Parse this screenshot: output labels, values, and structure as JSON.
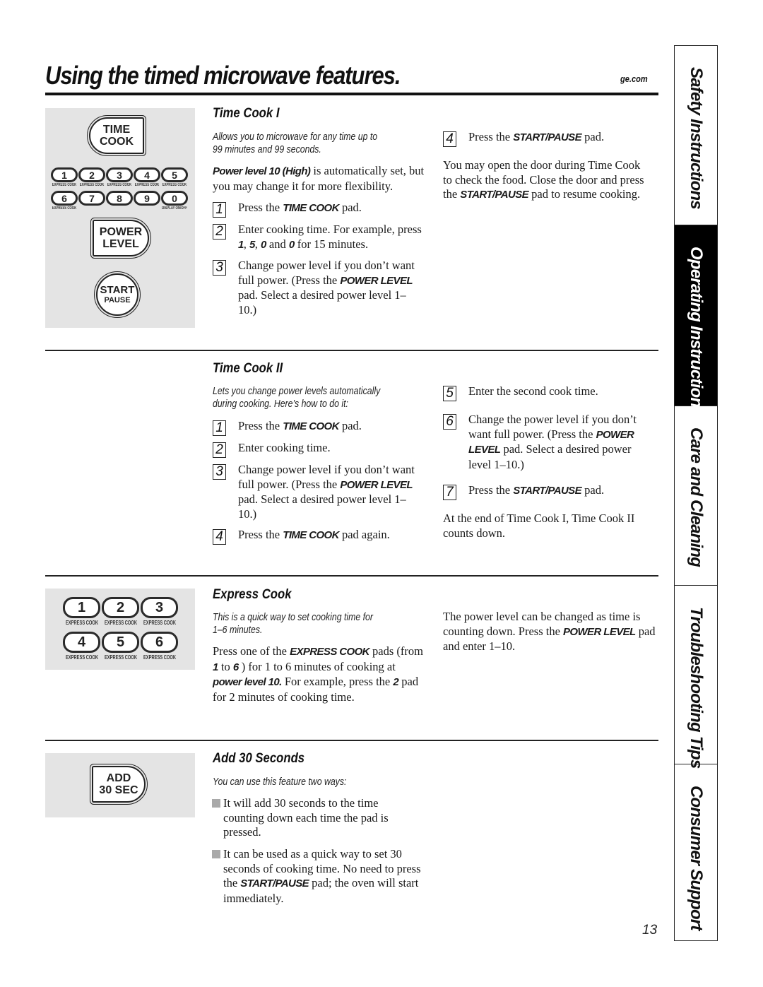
{
  "header": {
    "title": "Using the timed microwave features.",
    "site": "ge.com"
  },
  "side_tabs": [
    {
      "label": "Safety Instructions",
      "active": false
    },
    {
      "label": "Operating Instructions",
      "active": true
    },
    {
      "label": "Care and Cleaning",
      "active": false
    },
    {
      "label": "Troubleshooting Tips",
      "active": false
    },
    {
      "label": "Consumer Support",
      "active": false
    }
  ],
  "page_number": "13",
  "keypad_main": {
    "time_cook": [
      "TIME",
      "COOK"
    ],
    "number_keys_row1": [
      {
        "digit": "1",
        "label": "EXPRESS COOK"
      },
      {
        "digit": "2",
        "label": "EXPRESS COOK"
      },
      {
        "digit": "3",
        "label": "EXPRESS COOK"
      },
      {
        "digit": "4",
        "label": "EXPRESS COOK"
      },
      {
        "digit": "5",
        "label": "EXPRESS COOK"
      }
    ],
    "number_keys_row2": [
      {
        "digit": "6",
        "label": "EXPRESS COOK"
      },
      {
        "digit": "7",
        "label": ""
      },
      {
        "digit": "8",
        "label": ""
      },
      {
        "digit": "9",
        "label": ""
      },
      {
        "digit": "0",
        "label": "DISPLAY ON/OFF"
      }
    ],
    "power_level": [
      "POWER",
      "LEVEL"
    ],
    "start_pause": [
      "START",
      "PAUSE"
    ]
  },
  "keypad_express": {
    "keys": [
      {
        "digit": "1",
        "label": "EXPRESS COOK"
      },
      {
        "digit": "2",
        "label": "EXPRESS COOK"
      },
      {
        "digit": "3",
        "label": "EXPRESS COOK"
      },
      {
        "digit": "4",
        "label": "EXPRESS COOK"
      },
      {
        "digit": "5",
        "label": "EXPRESS COOK"
      },
      {
        "digit": "6",
        "label": "EXPRESS COOK"
      }
    ]
  },
  "keypad_add30": [
    "ADD",
    "30 SEC"
  ],
  "time_cook_1": {
    "heading": "Time Cook I",
    "intro_line1": "Allows you to microwave for any time up to",
    "intro_line2": "99 minutes and 99 seconds.",
    "power_note_bold": "Power level 10 (High)",
    "power_note_rest": " is automatically set, but you may change it for more flexibility.",
    "steps": [
      {
        "num": "1",
        "pre": "Press the ",
        "kw": "TIME COOK",
        "post": " pad."
      },
      {
        "num": "2",
        "pre": "Enter cooking time. For example, press ",
        "kw1": "1",
        "mid1": ", ",
        "kw2": "5",
        "mid2": ", ",
        "kw3": "0",
        "mid3": " and ",
        "kw4": "0",
        "post": " for 15 minutes."
      },
      {
        "num": "3",
        "pre": "Change power level if you don’t want full power. (Press the ",
        "kw": "POWER LEVEL",
        "post": " pad. Select a desired power level 1–10.)"
      },
      {
        "num": "4",
        "pre": "Press the ",
        "kw": "START/PAUSE",
        "post": " pad."
      }
    ],
    "door_note_pre": "You may open the door during Time Cook to check the food. Close the door and press the ",
    "door_note_kw": "START/PAUSE",
    "door_note_post": " pad to resume cooking."
  },
  "time_cook_2": {
    "heading": "Time Cook II",
    "intro_line1": "Lets you change power levels automatically",
    "intro_line2": "during cooking. Here’s how to do it:",
    "steps": [
      {
        "num": "1",
        "pre": "Press the ",
        "kw": "TIME COOK",
        "post": " pad."
      },
      {
        "num": "2",
        "text": "Enter cooking time."
      },
      {
        "num": "3",
        "pre": "Change power level if you don’t want full power. (Press the ",
        "kw": "POWER LEVEL",
        "post": " pad. Select a desired power level 1–10.)"
      },
      {
        "num": "4",
        "pre": "Press the ",
        "kw": "TIME COOK",
        "post": " pad again."
      },
      {
        "num": "5",
        "text": "Enter the second cook time."
      },
      {
        "num": "6",
        "pre": "Change the power level if you don’t want full power. (Press the ",
        "kw": "POWER LEVEL",
        "post": " pad. Select a desired power level 1–10.)"
      },
      {
        "num": "7",
        "pre": "Press the ",
        "kw": "START/PAUSE",
        "post": " pad."
      }
    ],
    "end_note": "At the end of Time Cook I, Time Cook II counts down."
  },
  "express_cook": {
    "heading": "Express Cook",
    "intro_line1": "This is a quick way to set cooking time for",
    "intro_line2": "1–6 minutes.",
    "body_pre": "Press one of the ",
    "body_kw": "EXPRESS COOK",
    "body_mid1": " pads (from ",
    "body_kw2": "1",
    "body_mid2": " to ",
    "body_kw3": "6",
    "body_mid3": " ) for 1 to 6 minutes of cooking at ",
    "body_kw4": "power level 10.",
    "body_mid4": "  For example, press the ",
    "body_kw5": "2",
    "body_post": " pad for 2 minutes of cooking time.",
    "note_pre": "The power level can be changed as time is counting down. Press the ",
    "note_kw": "POWER LEVEL",
    "note_post": " pad and enter 1–10."
  },
  "add_30": {
    "heading": "Add 30 Seconds",
    "intro": "You can use this feature two ways:",
    "bullet1": "It will add 30 seconds to the time counting down each time the pad is pressed.",
    "bullet2_pre": "It can be used as a quick way to set 30 seconds of cooking time. No need to press the ",
    "bullet2_kw": "START/PAUSE",
    "bullet2_post": " pad; the oven will start immediately."
  }
}
